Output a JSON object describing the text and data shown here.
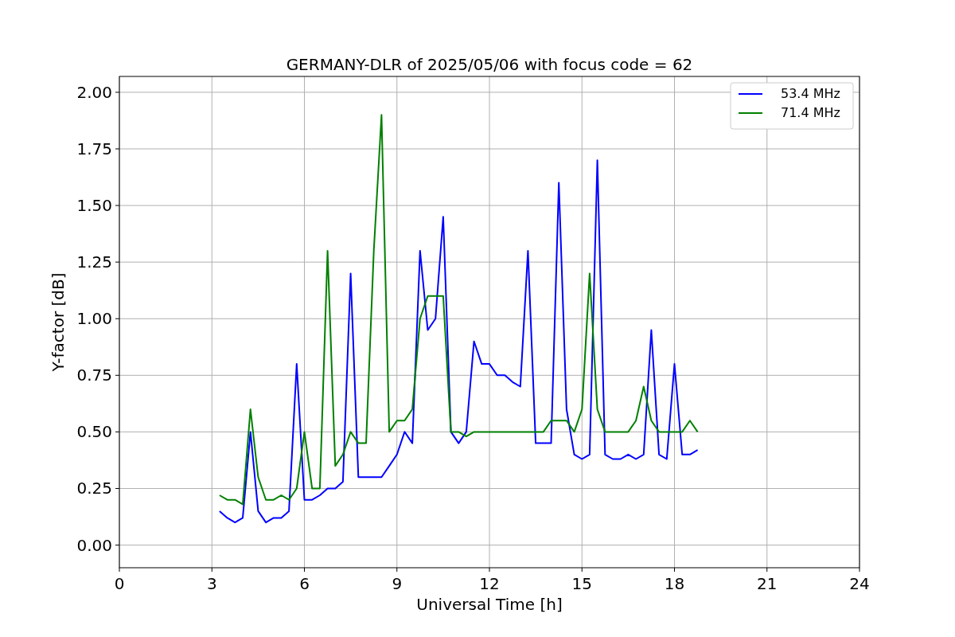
{
  "figure": {
    "chart_data": {
      "type": "line",
      "title": "GERMANY-DLR of 2025/05/06 with focus code = 62",
      "xlabel": "Universal Time [h]",
      "ylabel": "Y-factor [dB]",
      "x": [
        3.25,
        3.5,
        3.75,
        4.0,
        4.25,
        4.5,
        4.75,
        5.0,
        5.25,
        5.5,
        5.75,
        6.0,
        6.25,
        6.5,
        6.75,
        7.0,
        7.25,
        7.5,
        7.75,
        8.0,
        8.25,
        8.5,
        8.75,
        9.0,
        9.25,
        9.5,
        9.75,
        10.0,
        10.25,
        10.5,
        10.75,
        11.0,
        11.25,
        11.5,
        11.75,
        12.0,
        12.25,
        12.5,
        12.75,
        13.0,
        13.25,
        13.5,
        13.75,
        14.0,
        14.25,
        14.5,
        14.75,
        15.0,
        15.25,
        15.5,
        15.75,
        16.0,
        16.25,
        16.5,
        16.75,
        17.0,
        17.25,
        17.5,
        17.75,
        18.0,
        18.25,
        18.5,
        18.75
      ],
      "series": [
        {
          "name": "53.4 MHz",
          "color": "#0000ff",
          "values": [
            0.15,
            0.12,
            0.1,
            0.12,
            0.5,
            0.15,
            0.1,
            0.12,
            0.12,
            0.15,
            0.8,
            0.2,
            0.2,
            0.22,
            0.25,
            0.25,
            0.28,
            1.2,
            0.3,
            0.3,
            0.3,
            0.3,
            0.35,
            0.4,
            0.5,
            0.45,
            1.3,
            0.95,
            1.0,
            1.45,
            0.5,
            0.45,
            0.5,
            0.9,
            0.8,
            0.8,
            0.75,
            0.75,
            0.72,
            0.7,
            1.3,
            0.45,
            0.45,
            0.45,
            1.6,
            0.6,
            0.4,
            0.38,
            0.4,
            1.7,
            0.4,
            0.38,
            0.38,
            0.4,
            0.38,
            0.4,
            0.95,
            0.4,
            0.38,
            0.8,
            0.4,
            0.4,
            0.42
          ]
        },
        {
          "name": "71.4 MHz",
          "color": "#008000",
          "values": [
            0.22,
            0.2,
            0.2,
            0.18,
            0.6,
            0.3,
            0.2,
            0.2,
            0.22,
            0.2,
            0.25,
            0.5,
            0.25,
            0.25,
            1.3,
            0.35,
            0.4,
            0.5,
            0.45,
            0.45,
            1.3,
            1.9,
            0.5,
            0.55,
            0.55,
            0.6,
            1.0,
            1.1,
            1.1,
            1.1,
            0.5,
            0.5,
            0.48,
            0.5,
            0.5,
            0.5,
            0.5,
            0.5,
            0.5,
            0.5,
            0.5,
            0.5,
            0.5,
            0.55,
            0.55,
            0.55,
            0.5,
            0.6,
            1.2,
            0.6,
            0.5,
            0.5,
            0.5,
            0.5,
            0.55,
            0.7,
            0.55,
            0.5,
            0.5,
            0.5,
            0.5,
            0.55,
            0.5
          ]
        }
      ],
      "grid": true,
      "legend": "upper right",
      "xlim": [
        0,
        24
      ],
      "ylim": [
        -0.1,
        2.07
      ],
      "xticks": [
        0,
        3,
        6,
        9,
        12,
        15,
        18,
        21,
        24
      ],
      "yticks": [
        {
          "value": 0,
          "label": "0.00"
        },
        {
          "value": 0.25,
          "label": "0.25"
        },
        {
          "value": 0.5,
          "label": "0.50"
        },
        {
          "value": 0.75,
          "label": "0.75"
        },
        {
          "value": 1,
          "label": "1.00"
        },
        {
          "value": 1.25,
          "label": "1.25"
        },
        {
          "value": 1.5,
          "label": "1.50"
        },
        {
          "value": 1.75,
          "label": "1.75"
        },
        {
          "value": 2,
          "label": "2.00"
        }
      ]
    }
  }
}
